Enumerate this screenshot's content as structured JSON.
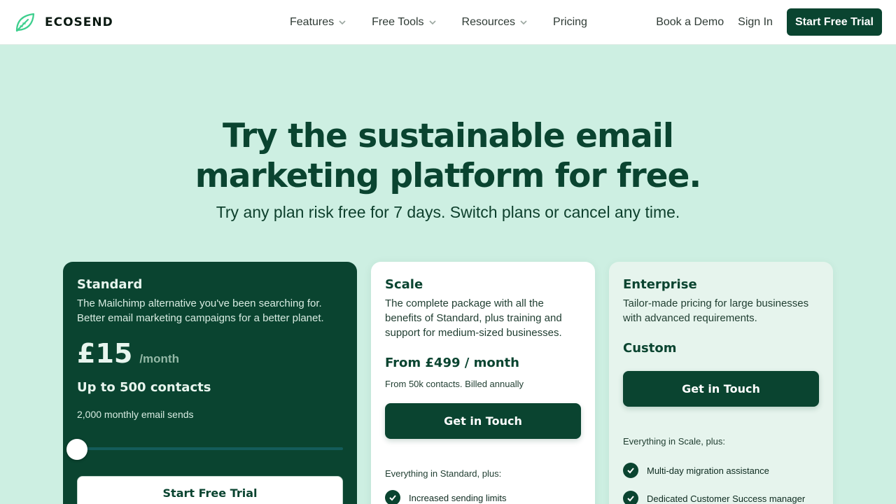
{
  "header": {
    "brand": "ECOSEND",
    "nav": [
      {
        "label": "Features",
        "dropdown": true
      },
      {
        "label": "Free Tools",
        "dropdown": true
      },
      {
        "label": "Resources",
        "dropdown": true
      },
      {
        "label": "Pricing",
        "dropdown": false
      }
    ],
    "book_demo": "Book a Demo",
    "sign_in": "Sign In",
    "cta": "Start Free Trial"
  },
  "hero": {
    "title_line1": "Try the sustainable email",
    "title_line2": "marketing platform for free.",
    "subtitle": "Try any plan risk free for 7 days. Switch plans or cancel any time."
  },
  "plans": {
    "standard": {
      "name": "Standard",
      "description": "The Mailchimp alternative you've been searching for. Better email marketing campaigns for a better planet.",
      "price": "£15",
      "period": "/month",
      "contacts": "Up to 500 contacts",
      "sends": "2,000 monthly email sends",
      "slider_value": 0,
      "cta": "Start Free Trial"
    },
    "scale": {
      "name": "Scale",
      "description": "The complete package with all the benefits of Standard, plus training and support for medium-sized businesses.",
      "price": "From £499 / month",
      "note": "From 50k contacts. Billed annually",
      "cta": "Get in Touch",
      "includes": "Everything in Standard, plus:",
      "features": [
        "Increased sending limits"
      ]
    },
    "enterprise": {
      "name": "Enterprise",
      "description": "Tailor-made pricing for large businesses with advanced requirements.",
      "price": "Custom",
      "cta": "Get in Touch",
      "includes": "Everything in Scale, plus:",
      "features": [
        "Multi-day migration assistance",
        "Dedicated Customer Success manager"
      ]
    }
  },
  "colors": {
    "brand_dark": "#0a4430",
    "page_bg": "#cdefe2",
    "logo_green": "#3ecf8e"
  },
  "icons": {
    "logo": "leaf-icon",
    "dropdown": "chevron-down-icon",
    "feature": "check-circle-icon"
  }
}
